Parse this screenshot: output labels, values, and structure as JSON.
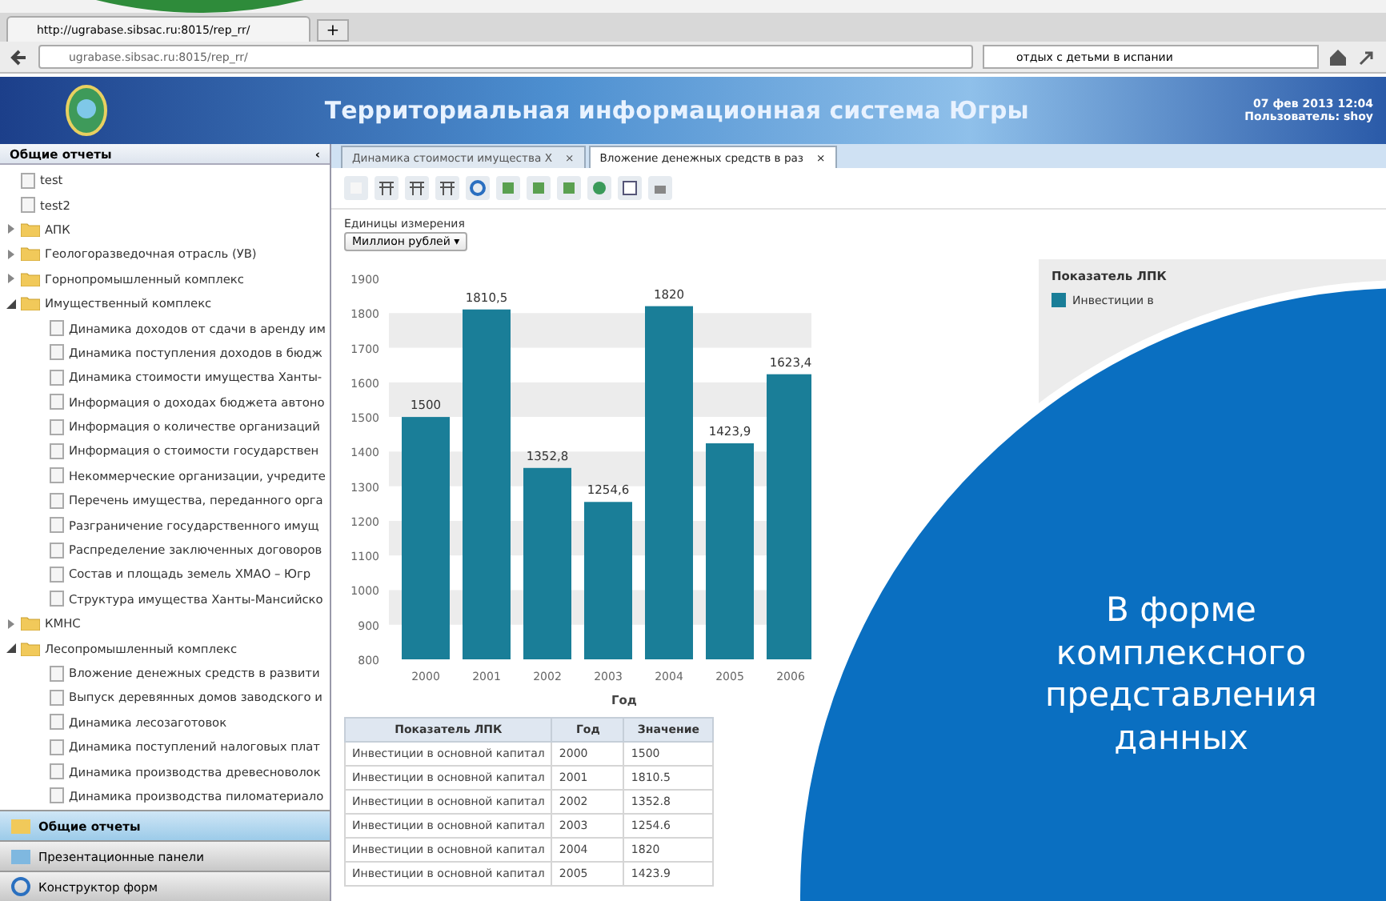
{
  "browser": {
    "tab_title": "http://ugrabase.sibsac.ru:8015/rep_rr/",
    "new_tab": "+",
    "address": "ugrabase.sibsac.ru:8015/rep_rr/",
    "search": "отдых с детьми в испании"
  },
  "banner": {
    "title": "Территориальная информационная система Югры",
    "date": "07 фев 2013 12:04",
    "user": "Пользователь: shoy"
  },
  "sidebar": {
    "title": "Общие отчеты",
    "collapse": "‹",
    "tree": [
      {
        "label": "test",
        "kind": "report"
      },
      {
        "label": "test2",
        "kind": "report"
      },
      {
        "label": "АПК",
        "kind": "folder",
        "expanded": false
      },
      {
        "label": "Геологоразведочная отрасль (УВ)",
        "kind": "folder",
        "expanded": false
      },
      {
        "label": "Горнопромышленный комплекс",
        "kind": "folder",
        "expanded": false
      },
      {
        "label": "Имущественный комплекс",
        "kind": "folder",
        "expanded": true,
        "children": [
          {
            "label": "Динамика доходов от сдачи в аренду им",
            "kind": "report"
          },
          {
            "label": "Динамика поступления доходов в бюдж",
            "kind": "report"
          },
          {
            "label": "Динамика стоимости имущества Ханты-",
            "kind": "report"
          },
          {
            "label": "Информация о доходах бюджета автоно",
            "kind": "report"
          },
          {
            "label": "Информация о количестве организаций",
            "kind": "report"
          },
          {
            "label": "Информация о стоимости государствен",
            "kind": "report"
          },
          {
            "label": "Некоммерческие организации, учредите",
            "kind": "report"
          },
          {
            "label": "Перечень имущества, переданного орга",
            "kind": "report"
          },
          {
            "label": "Разграничение государственного имущ",
            "kind": "report"
          },
          {
            "label": "Распределение заключенных договоров",
            "kind": "report"
          },
          {
            "label": "Состав и площадь земель ХМАО – Югр",
            "kind": "report"
          },
          {
            "label": "Структура имущества Ханты-Мансийско",
            "kind": "report"
          }
        ]
      },
      {
        "label": "КМНС",
        "kind": "folder",
        "expanded": false
      },
      {
        "label": "Лесопромышленный комплекс",
        "kind": "folder",
        "expanded": true,
        "children": [
          {
            "label": "Вложение денежных средств в развити",
            "kind": "report"
          },
          {
            "label": "Выпуск деревянных домов заводского и",
            "kind": "report"
          },
          {
            "label": "Динамика лесозаготовок",
            "kind": "report"
          },
          {
            "label": "Динамика поступлений налоговых плат",
            "kind": "report"
          },
          {
            "label": "Динамика производства древесноволок",
            "kind": "report"
          },
          {
            "label": "Динамика производства пиломатериало",
            "kind": "report"
          }
        ]
      }
    ],
    "nav": [
      {
        "label": "Общие отчеты",
        "selected": true
      },
      {
        "label": "Презентационные панели",
        "selected": false
      },
      {
        "label": "Конструктор форм",
        "selected": false
      }
    ]
  },
  "tabs": [
    {
      "label": "Динамика стоимости имущества Х",
      "close": "×",
      "selected": false
    },
    {
      "label": "Вложение денежных средств в раз",
      "close": "×",
      "selected": true
    }
  ],
  "units": {
    "label": "Единицы измерения",
    "value": "Миллион рублей",
    "caret": "▾"
  },
  "chart_data": {
    "type": "bar",
    "xlabel": "Год",
    "categories": [
      "2000",
      "2001",
      "2002",
      "2003",
      "2004",
      "2005",
      "2006"
    ],
    "series": [
      {
        "color": "#1a7e98",
        "values": [
          1500,
          1810.5,
          1352.8,
          1254.6,
          1820,
          1423.9,
          1623.4
        ]
      }
    ],
    "value_labels": [
      "1500",
      "1810,5",
      "1352,8",
      "1254,6",
      "1820",
      "1423,9",
      "1623,4"
    ],
    "ylim": [
      800,
      1900
    ],
    "yticks": [
      800,
      900,
      1000,
      1100,
      1200,
      1300,
      1400,
      1500,
      1600,
      1700,
      1800,
      1900
    ]
  },
  "legend": {
    "title": "Показатель ЛПК",
    "items": [
      {
        "label": "Инвестиции в",
        "color": "#1a7e98"
      }
    ]
  },
  "table": {
    "columns": [
      "Показатель ЛПК",
      "Год",
      "Значение"
    ],
    "rows": [
      [
        "Инвестиции в основной капитал",
        "2000",
        "1500"
      ],
      [
        "Инвестиции в основной капитал",
        "2001",
        "1810.5"
      ],
      [
        "Инвестиции в основной капитал",
        "2002",
        "1352.8"
      ],
      [
        "Инвестиции в основной капитал",
        "2003",
        "1254.6"
      ],
      [
        "Инвестиции в основной капитал",
        "2004",
        "1820"
      ],
      [
        "Инвестиции в основной капитал",
        "2005",
        "1423.9"
      ]
    ]
  },
  "overlay": {
    "text": "В форме комплексного представления данных"
  }
}
